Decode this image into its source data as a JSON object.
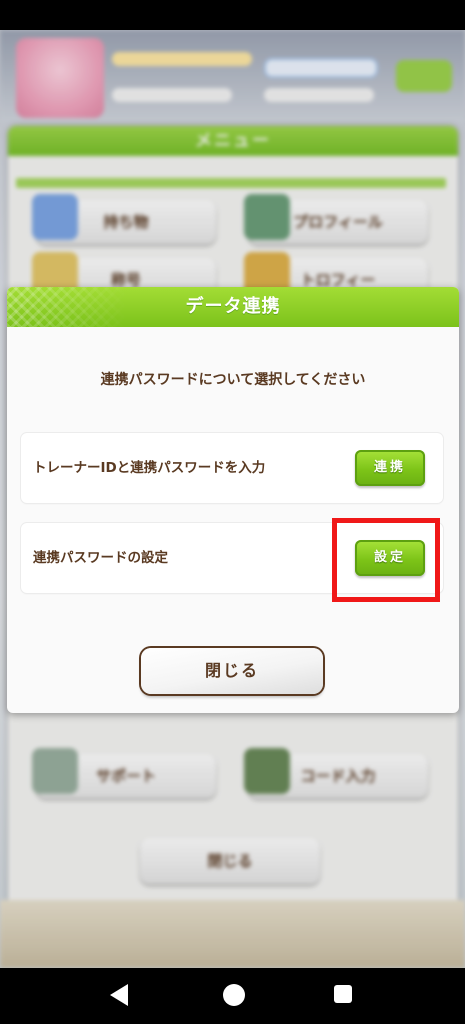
{
  "background_menu": {
    "header_title": "メニュー",
    "items": [
      {
        "label": "持ち物"
      },
      {
        "label": "プロフィール"
      },
      {
        "label": "称号"
      },
      {
        "label": "トロフィー"
      },
      {
        "label": "サポート"
      },
      {
        "label": "コード入力"
      }
    ],
    "close_label": "閉じる"
  },
  "dialog": {
    "title": "データ連携",
    "message": "連携パスワードについて選択してください",
    "options": [
      {
        "label": "トレーナーIDと連携パスワードを入力",
        "button": "連携"
      },
      {
        "label": "連携パスワードの設定",
        "button": "設定"
      }
    ],
    "close_label": "閉じる"
  },
  "highlight": {
    "target": "設定",
    "color": "#f01818"
  },
  "colors": {
    "accent_green": "#7cc21b",
    "text_brown": "#5a3a22"
  },
  "system_nav": {
    "back_icon": "back-icon",
    "home_icon": "home-icon",
    "recents_icon": "recents-icon"
  }
}
